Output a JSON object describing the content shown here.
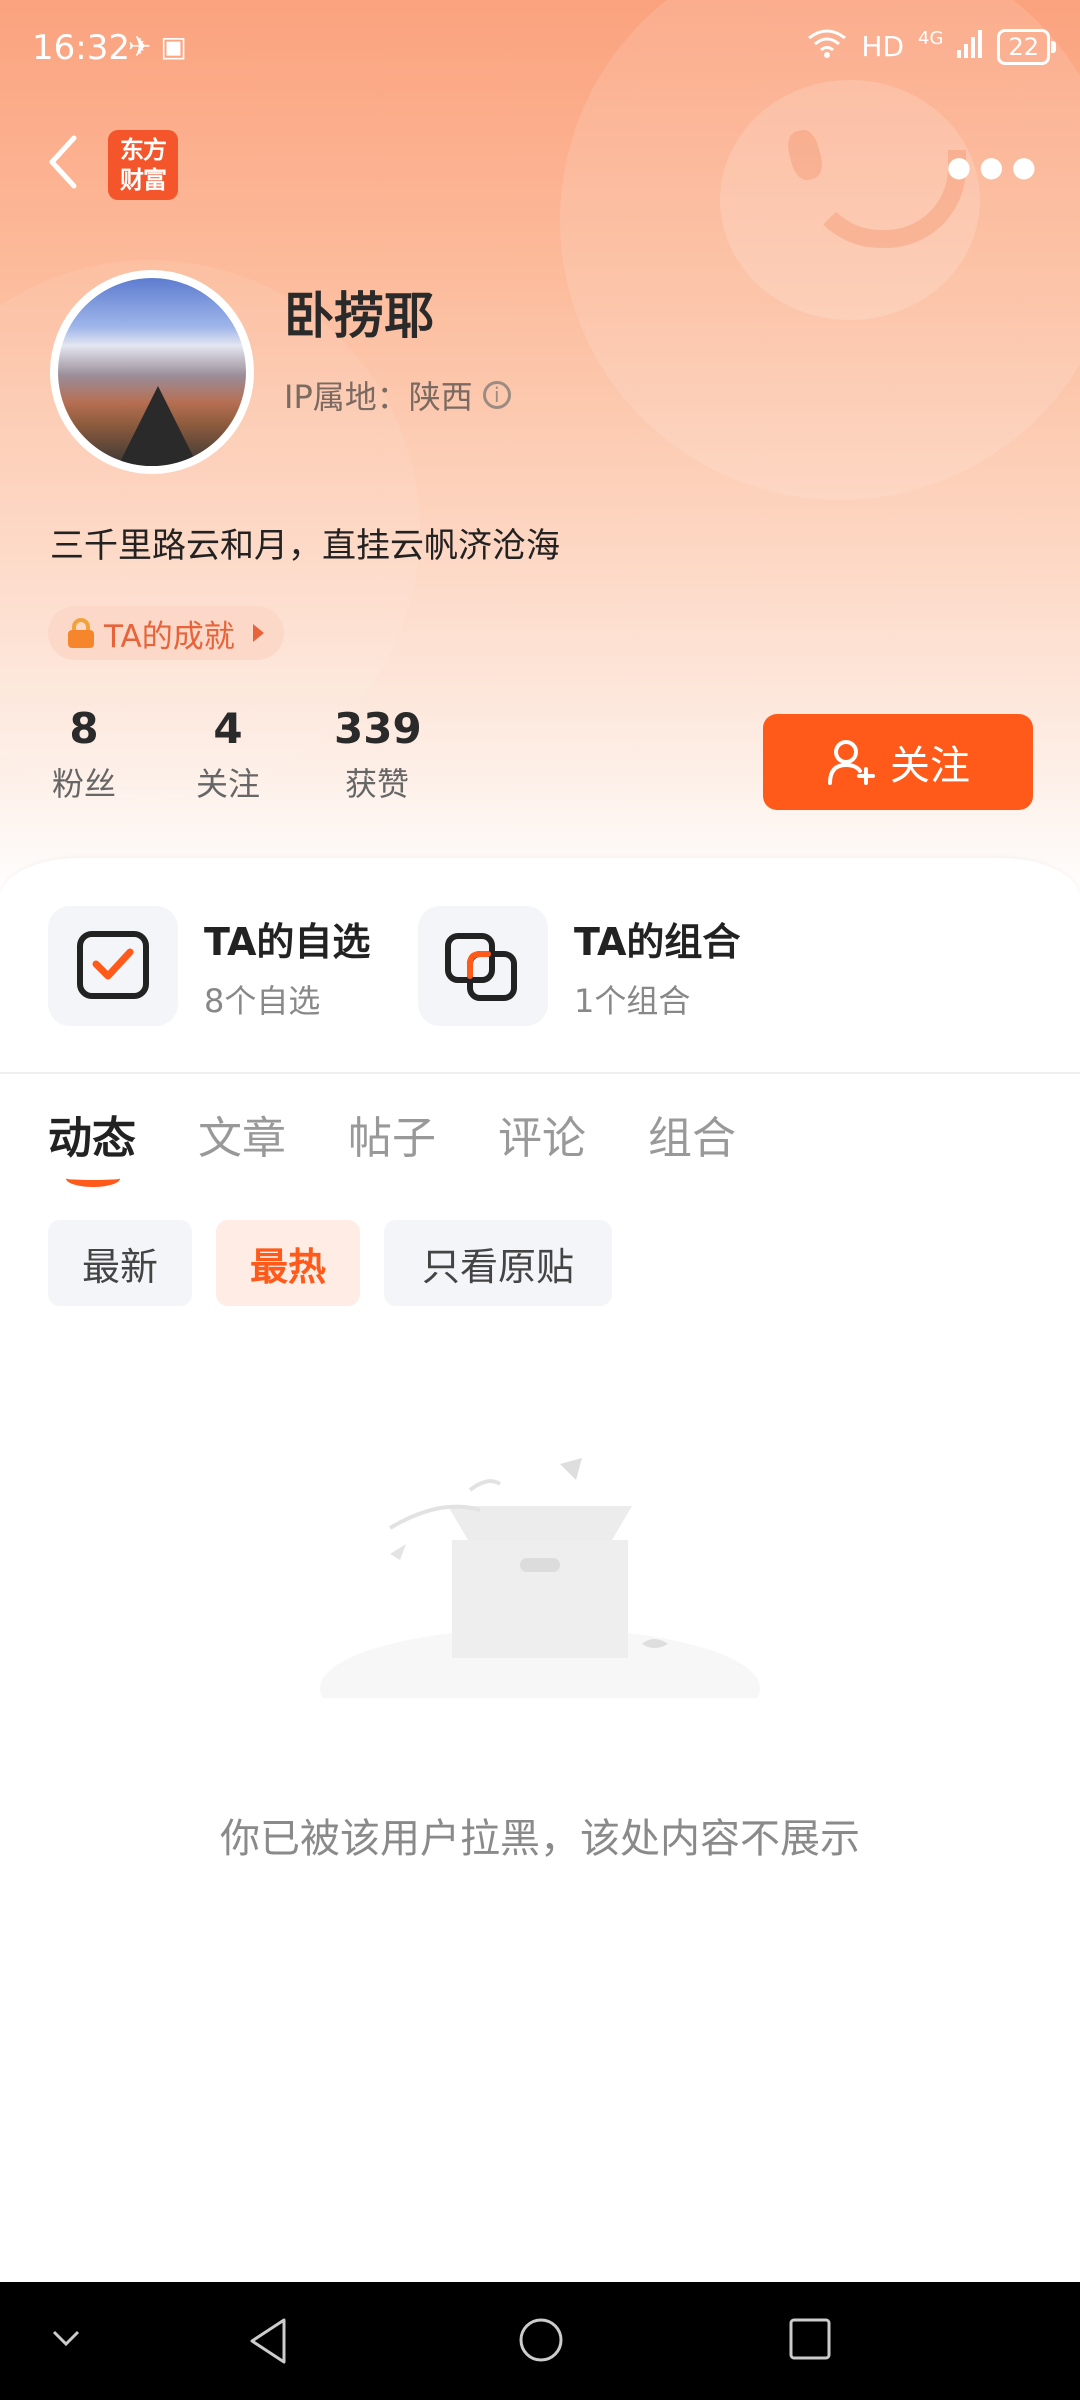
{
  "status_bar": {
    "time": "16:32",
    "network": "HD",
    "signal_type": "4G",
    "battery": "22"
  },
  "header": {
    "logo_text": "东方财富"
  },
  "profile": {
    "name": "卧捞耶",
    "ip_location": "IP属地：陕西",
    "bio": "三千里路云和月，直挂云帆济沧海",
    "achievement_label": "TA的成就"
  },
  "stats": [
    {
      "value": "8",
      "label": "粉丝"
    },
    {
      "value": "4",
      "label": "关注"
    },
    {
      "value": "339",
      "label": "获赞"
    }
  ],
  "follow_button": {
    "label": "关注"
  },
  "portfolio_cards": [
    {
      "title": "TA的自选",
      "subtitle": "8个自选"
    },
    {
      "title": "TA的组合",
      "subtitle": "1个组合"
    }
  ],
  "tabs": [
    "动态",
    "文章",
    "帖子",
    "评论",
    "组合"
  ],
  "active_tab": "动态",
  "filters": [
    "最新",
    "最热",
    "只看原贴"
  ],
  "active_filter": "最热",
  "empty_message": "你已被该用户拉黑，该处内容不展示",
  "colors": {
    "accent": "#ff5a1a",
    "hero_top": "#fba27e"
  }
}
